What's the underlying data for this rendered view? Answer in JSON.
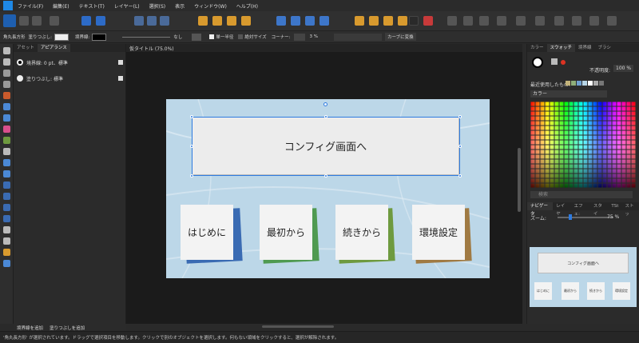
{
  "menubar": {
    "items": [
      "ファイル(F)",
      "編集(E)",
      "テキスト(T)",
      "レイヤー(L)",
      "選択(S)",
      "表示",
      "ウィンドウ(W)",
      "ヘルプ(H)"
    ]
  },
  "context": {
    "shape_type": "角丸長方形",
    "fill_label": "塗りつぶし:",
    "stroke_label": "境界線:",
    "stroke_none": "なし",
    "single_stroke": "単一半径",
    "absolute_size": "絶対サイズ",
    "corner_label": "コーナー:",
    "corner_value": "3 %",
    "convert_curves": "カーブに変換"
  },
  "left_panel": {
    "tabs": [
      "アセット",
      "アピアランス"
    ],
    "rows": [
      {
        "label": "境界線: 0 pt、標準"
      },
      {
        "label": "塗りつぶし: 標準"
      }
    ],
    "add_stroke": "境界線を追加",
    "add_fill": "塗りつぶしを追加"
  },
  "document": {
    "tab_title": "仮タイトル (75.0%)",
    "config_button": "コンフィグ画面へ",
    "cards": [
      {
        "label": "はじめに",
        "shadow": "#3a6bb3"
      },
      {
        "label": "最初から",
        "shadow": "#4f9a51"
      },
      {
        "label": "続きから",
        "shadow": "#6e9a3f"
      },
      {
        "label": "環境設定",
        "shadow": "#a07a43"
      }
    ]
  },
  "right_panel": {
    "top_tabs": [
      "カラー",
      "スウォッチ",
      "境界線",
      "ブラシ"
    ],
    "opacity_label": "不透明度:",
    "opacity_value": "100 %",
    "recent_label": "最近使用したもの:",
    "palette_name": "カラー",
    "search_placeholder": "検索",
    "bottom_tabs": [
      "ナビゲータ",
      "レイヤ",
      "エフェ:",
      "スタイ",
      "TSt",
      "ストッ"
    ],
    "zoom_label": "ズーム:",
    "zoom_value": "75 %",
    "thumb_config": "コンフィグ画面へ",
    "thumb_cards": [
      "はじめに",
      "最初から",
      "続きから",
      "環境設定"
    ]
  },
  "status": {
    "text": "'角丸長方形' が選択されています。ドラッグで選択項目を移動します。クリックで別のオブジェクトを選択します。何もない領域をクリックすると、選択が解除されます。"
  },
  "colors": {
    "accent": "#2e7be0",
    "canvas_bg": "#1b1b1b",
    "doc_bg": "#bcd7e8"
  }
}
